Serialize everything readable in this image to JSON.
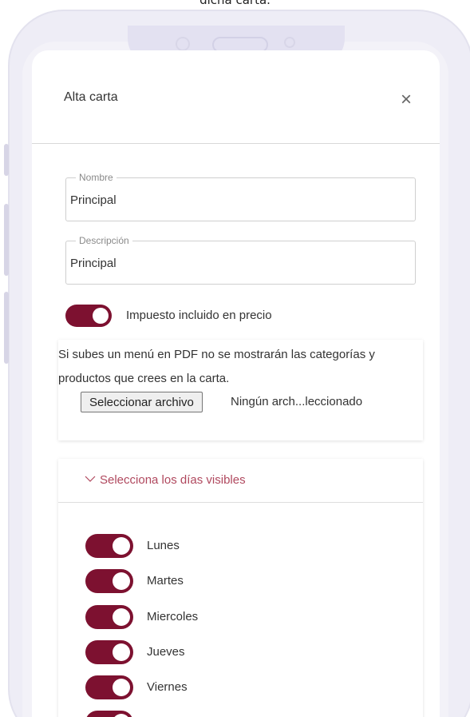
{
  "caption": "dicha carta.",
  "modal": {
    "title": "Alta carta",
    "close_glyph": "×"
  },
  "form": {
    "nombre": {
      "legend": "Nombre",
      "value": "Principal"
    },
    "descripcion": {
      "legend": "Descripción",
      "value": "Principal"
    },
    "tax_toggle": {
      "label": "Impuesto incluido en precio",
      "checked": true
    }
  },
  "pdf": {
    "info_text": "Si subes un menú en PDF no se mostrarán las categorías y productos que crees en la carta.",
    "file_button": "Seleccionar archivo",
    "file_status": "Ningún arch...leccionado"
  },
  "days": {
    "title": "Selecciona los días visibles",
    "items": [
      {
        "label": "Lunes",
        "checked": true
      },
      {
        "label": "Martes",
        "checked": true
      },
      {
        "label": "Miercoles",
        "checked": true
      },
      {
        "label": "Jueves",
        "checked": true
      },
      {
        "label": "Viernes",
        "checked": true
      }
    ]
  },
  "colors": {
    "toggle_on": "#7d1130",
    "accent_text": "#b0485e",
    "phone_frame": "#eeedf6"
  },
  "icons": {
    "close": "close-icon",
    "chevron": "chevron-down-icon"
  }
}
